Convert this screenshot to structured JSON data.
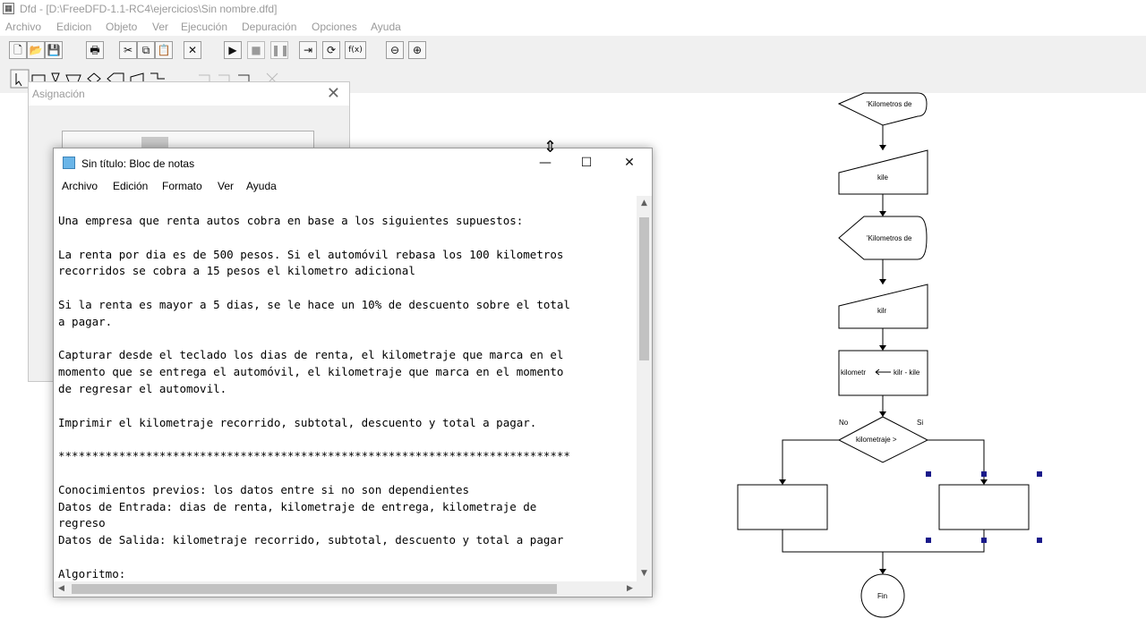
{
  "dfd": {
    "title": "Dfd - [D:\\FreeDFD-1.1-RC4\\ejercicios\\Sin nombre.dfd]",
    "menu": [
      "Archivo",
      "Edicion",
      "Objeto",
      "Ver",
      "Ejecución",
      "Depuración",
      "Opciones",
      "Ayuda"
    ],
    "toolbar": {
      "new": "🗋",
      "open": "📂",
      "save": "💾",
      "print": "🖶",
      "cut": "✂",
      "copy": "⧉",
      "paste": "📋",
      "delete": "✕",
      "run": "▶",
      "stop": "■",
      "pause": "❚❚",
      "step": "⇥",
      "trace": "⟳",
      "eval": "f(x)",
      "zoom_out": "⊖",
      "zoom_in": "⊕"
    }
  },
  "asignacion": {
    "title": "Asignación",
    "close": "✕"
  },
  "notepad": {
    "title": "Sin título: Bloc de notas",
    "minimize": "—",
    "maximize": "☐",
    "close": "✕",
    "menu": [
      "Archivo",
      "Edición",
      "Formato",
      "Ver",
      "Ayuda"
    ],
    "lines": [
      "Una empresa que renta autos cobra en base a los siguientes supuestos:",
      "",
      "La renta por dia es de 500 pesos. Si el automóvil rebasa los 100 kilometros",
      "recorridos se cobra a 15 pesos el kilometro adicional",
      "",
      "Si la renta es mayor a 5 dias, se le hace un 10% de descuento sobre el total",
      "a pagar.",
      "",
      "Capturar desde el teclado los dias de renta, el kilometraje que marca en el",
      "momento que se entrega el automóvil, el kilometraje que marca en el momento",
      "de regresar el automovil.",
      "",
      "Imprimir el kilometraje recorrido, subtotal, descuento y total a pagar.",
      "",
      "****************************************************************************",
      "",
      "Conocimientos previos: los datos entre si no son dependientes",
      "Datos de Entrada: dias de renta, kilometraje de entrega, kilometraje de",
      "regreso",
      "Datos de Salida: kilometraje recorrido, subtotal, descuento y total a pagar",
      "",
      "Algoritmo:"
    ],
    "scroll_up": "▲",
    "scroll_down": "▼",
    "scroll_left": "◀",
    "scroll_right": "▶"
  },
  "flowchart": {
    "output1": "'Kilometros de",
    "input1": "kile",
    "output2": "'Kilometros de",
    "input2": "kilr",
    "assign_left": "kilometr",
    "assign_right": "kilr - kile",
    "decision": "kilometraje >",
    "no_label": "No",
    "yes_label": "Si",
    "end": "Fin"
  },
  "cursor": "⇕"
}
